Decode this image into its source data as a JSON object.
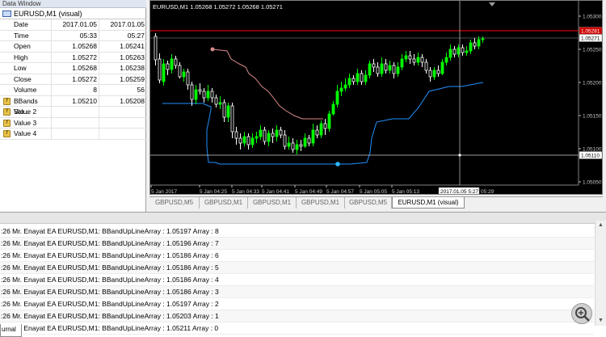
{
  "data_window": {
    "title": "Data Window",
    "header": "EURUSD,M1 (visual)",
    "rows": [
      {
        "label": "Date",
        "v1": "2017.01.05",
        "v2": "2017.01.05",
        "icon": false
      },
      {
        "label": "Time",
        "v1": "05:33",
        "v2": "05:27",
        "icon": false
      },
      {
        "label": "Open",
        "v1": "1.05268",
        "v2": "1.05241",
        "icon": false
      },
      {
        "label": "High",
        "v1": "1.05272",
        "v2": "1.05263",
        "icon": false
      },
      {
        "label": "Low",
        "v1": "1.05268",
        "v2": "1.05238",
        "icon": false
      },
      {
        "label": "Close",
        "v1": "1.05272",
        "v2": "1.05259",
        "icon": false
      },
      {
        "label": "Volume",
        "v1": "8",
        "v2": "56",
        "icon": false
      },
      {
        "label": "BBands Sto...",
        "v1": "1.05210",
        "v2": "1.05208",
        "icon": true
      },
      {
        "label": "Value 2",
        "v1": "",
        "v2": "",
        "icon": true
      },
      {
        "label": "Value 3",
        "v1": "",
        "v2": "",
        "icon": true
      },
      {
        "label": "Value 4",
        "v1": "",
        "v2": "",
        "icon": true
      }
    ]
  },
  "chart": {
    "title": "EURUSD,M1  1.05268 1.05272 1.05268 1.05271",
    "price_labels": [
      "1.05300",
      "1.05250",
      "1.05200",
      "1.05150",
      "1.05100",
      "1.05050"
    ],
    "current_price": "1.05271",
    "ask_price": "1.05281",
    "cross_price": "1.05110",
    "time_labels": [
      "5 Jan 2017",
      "5 Jan 04:25",
      "5 Jan 04:33",
      "5 Jan 04:41",
      "5 Jan 04:49",
      "5 Jan 04:57",
      "5 Jan 05:05",
      "5 Jan 05:13"
    ],
    "cross_time": "2017.01.05 5:27",
    "last_time": "05:29",
    "colors": {
      "bull": "#00ff00",
      "bear": "#ffffff",
      "upper_band": "#d98a8a",
      "lower_band": "#1e90ff",
      "ask_line": "#ff0000"
    }
  },
  "chart_tabs": [
    "GBPUSD,M5",
    "GBPUSD,M1",
    "GBPUSD,M1",
    "GBPUSD,M1",
    "GBPUSD,M5",
    "EURUSD,M1 (visual)"
  ],
  "journal": {
    "tab": "urnal",
    "rows": [
      ":26  Mr. Enayat EA EURUSD,M1: BBandUpLineArray : 1.05197   Array : 8",
      ":26  Mr. Enayat EA EURUSD,M1: BBandUpLineArray : 1.05196   Array : 7",
      ":26  Mr. Enayat EA EURUSD,M1: BBandUpLineArray : 1.05186   Array : 6",
      ":26  Mr. Enayat EA EURUSD,M1: BBandUpLineArray : 1.05186   Array : 5",
      ":26  Mr. Enayat EA EURUSD,M1: BBandUpLineArray : 1.05186   Array : 4",
      ":26  Mr. Enayat EA EURUSD,M1: BBandUpLineArray : 1.05186   Array : 3",
      ":26  Mr. Enayat EA EURUSD,M1: BBandUpLineArray : 1.05197   Array : 2",
      ":26  Mr. Enayat EA EURUSD,M1: BBandUpLineArray : 1.05203   Array : 1",
      ":26  Mr. Enayat EA EURUSD,M1: BBandUpLineArray : 1.05211   Array : 0"
    ]
  }
}
